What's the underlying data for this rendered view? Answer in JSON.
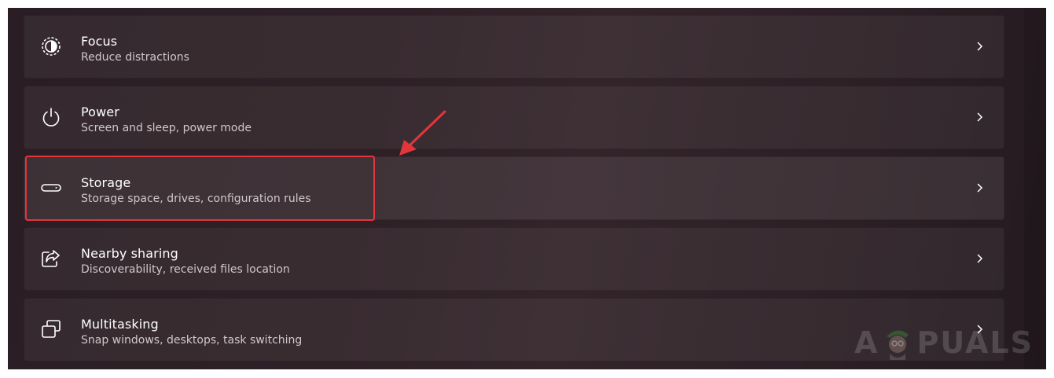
{
  "settings": {
    "items": [
      {
        "title": "Focus",
        "subtitle": "Reduce distractions",
        "icon": "focus-icon"
      },
      {
        "title": "Power",
        "subtitle": "Screen and sleep, power mode",
        "icon": "power-icon"
      },
      {
        "title": "Storage",
        "subtitle": "Storage space, drives, configuration rules",
        "icon": "storage-icon"
      },
      {
        "title": "Nearby sharing",
        "subtitle": "Discoverability, received files location",
        "icon": "nearby-sharing-icon"
      },
      {
        "title": "Multitasking",
        "subtitle": "Snap windows, desktops, task switching",
        "icon": "multitasking-icon"
      }
    ]
  },
  "annotation": {
    "highlight_color": "#e0363c",
    "highlighted_item": "Storage"
  },
  "watermark": {
    "text_left": "A",
    "text_right": "PUALS"
  }
}
